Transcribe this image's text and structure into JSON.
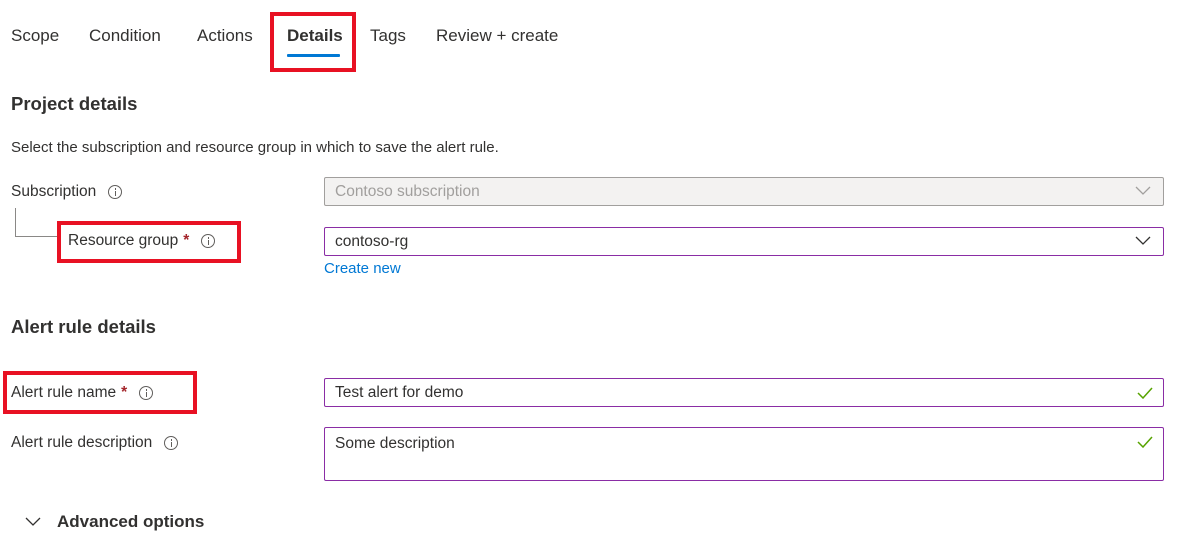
{
  "tabs": [
    {
      "label": "Scope",
      "active": false
    },
    {
      "label": "Condition",
      "active": false
    },
    {
      "label": "Actions",
      "active": false
    },
    {
      "label": "Details",
      "active": true
    },
    {
      "label": "Tags",
      "active": false
    },
    {
      "label": "Review + create",
      "active": false
    }
  ],
  "project_details": {
    "title": "Project details",
    "description": "Select the subscription and resource group in which to save the alert rule.",
    "subscription": {
      "label": "Subscription",
      "value": "Contoso subscription",
      "disabled": true
    },
    "resource_group": {
      "label": "Resource group",
      "required_marker": "*",
      "value": "contoso-rg",
      "create_new_label": "Create new"
    }
  },
  "alert_rule_details": {
    "title": "Alert rule details",
    "name": {
      "label": "Alert rule name",
      "required_marker": "*",
      "value": "Test alert for demo",
      "valid": true
    },
    "description": {
      "label": "Alert rule description",
      "value": "Some description",
      "valid": true
    }
  },
  "advanced_options": {
    "label": "Advanced options",
    "expanded": false
  },
  "colors": {
    "accent": "#0078d4",
    "highlight_box": "#e81123",
    "field_border": "#8a2da5",
    "required": "#a4262c",
    "valid_check": "#57a300"
  }
}
